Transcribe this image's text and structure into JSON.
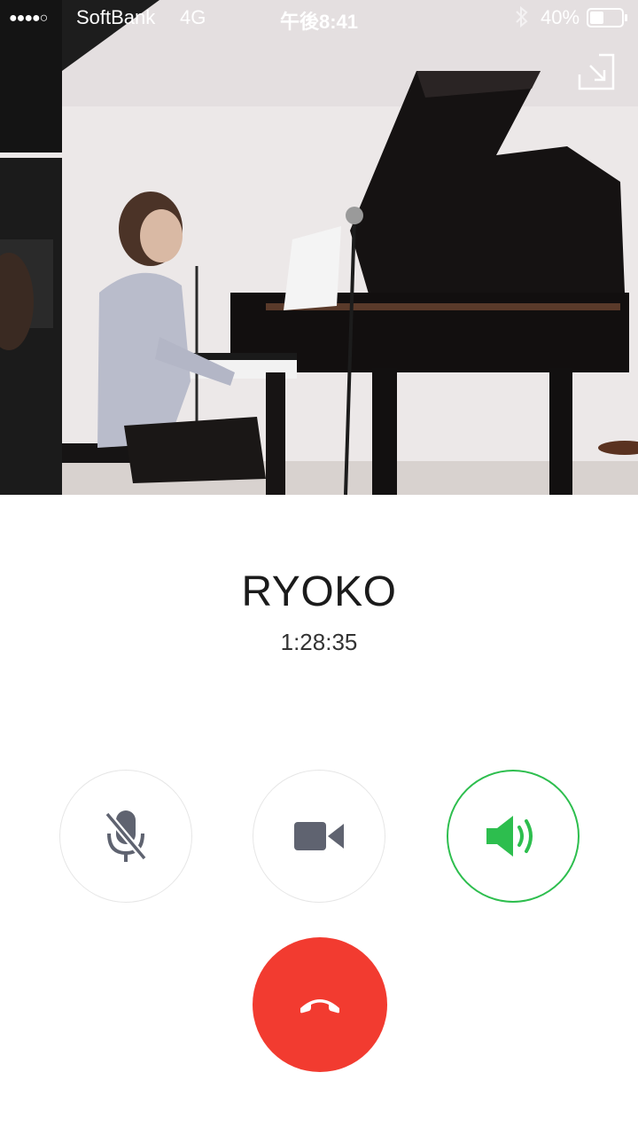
{
  "status_bar": {
    "signal": "●●●●○",
    "carrier": "SoftBank",
    "network": "4G",
    "time": "午後8:41",
    "battery": "40%",
    "bluetooth_icon": "bluetooth-icon"
  },
  "call": {
    "name": "RYOKO",
    "duration": "1:28:35"
  },
  "controls": {
    "mute_icon": "microphone-off-icon",
    "video_icon": "video-camera-icon",
    "speaker_icon": "speaker-icon",
    "end_call_icon": "phone-hangup-icon",
    "minimize_icon": "minimize-arrow-icon"
  },
  "colors": {
    "speaker_active": "#2dbe4e",
    "end_call": "#f23b30",
    "icon_gray": "#5f6370"
  }
}
